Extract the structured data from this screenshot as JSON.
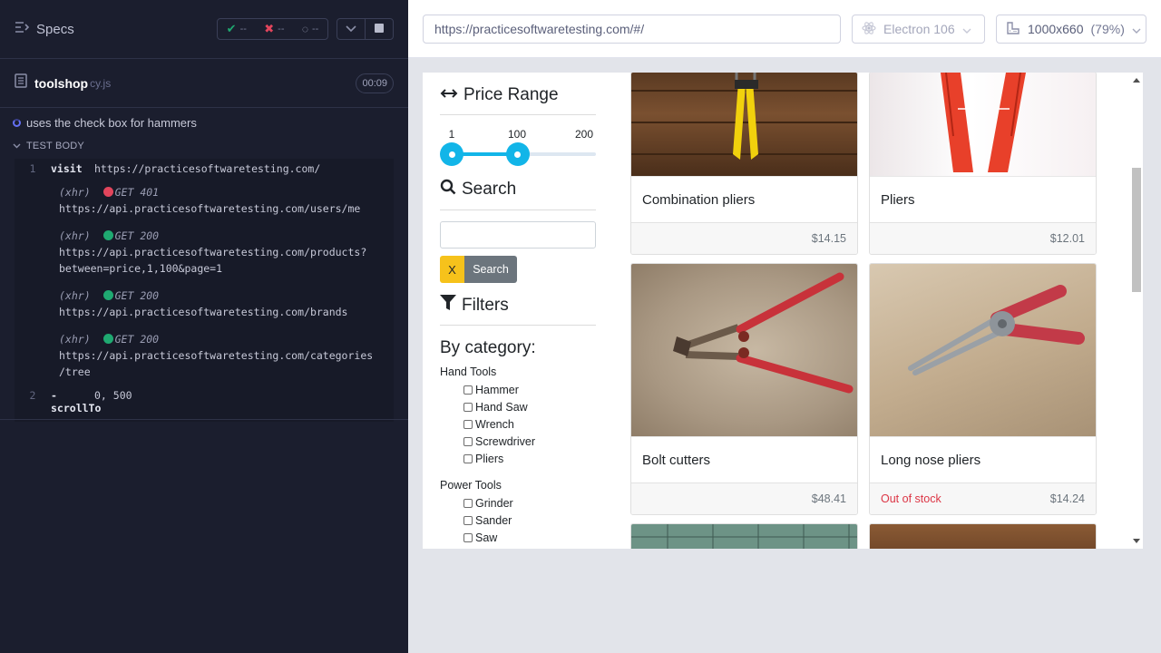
{
  "runner": {
    "specs_label": "Specs",
    "stats": {
      "passed": "--",
      "failed": "--",
      "pending": "--"
    },
    "spec": {
      "name": "toolshop",
      "ext": "cy.js",
      "duration": "00:09"
    },
    "test_title": "uses the check box for hammers",
    "test_body_label": "TEST BODY",
    "commands": [
      {
        "num": "1",
        "name": "visit",
        "message": "https://practicesoftwaretesting.com/"
      },
      {
        "num": "2",
        "name": "-scrollTo",
        "message": "0, 500"
      }
    ],
    "xhr": [
      {
        "tag": "(xhr)",
        "status_color": "#e2455c",
        "method": "GET 401",
        "url": "https://api.practicesoftwaretesting.com/users/me"
      },
      {
        "tag": "(xhr)",
        "status_color": "#1fa971",
        "method": "GET 200",
        "url": "https://api.practicesoftwaretesting.com/products?between=price,1,100&page=1"
      },
      {
        "tag": "(xhr)",
        "status_color": "#1fa971",
        "method": "GET 200",
        "url": "https://api.practicesoftwaretesting.com/brands"
      },
      {
        "tag": "(xhr)",
        "status_color": "#1fa971",
        "method": "GET 200",
        "url": "https://api.practicesoftwaretesting.com/categories/tree"
      }
    ]
  },
  "aut": {
    "url": "https://practicesoftwaretesting.com/#/",
    "browser": "Electron 106",
    "viewport": "1000x660",
    "zoom": "(79%)"
  },
  "app": {
    "price_range": {
      "title": "Price Range",
      "min_label": "1",
      "current_label": "100",
      "max_label": "200",
      "min": 1,
      "max": 200,
      "low_value": 1,
      "high_value": 100
    },
    "search": {
      "title": "Search",
      "clear_label": "X",
      "button_label": "Search",
      "value": ""
    },
    "filters": {
      "title": "Filters",
      "by_category": "By category:",
      "groups": [
        {
          "name": "Hand Tools",
          "items": [
            "Hammer",
            "Hand Saw",
            "Wrench",
            "Screwdriver",
            "Pliers"
          ]
        },
        {
          "name": "Power Tools",
          "items": [
            "Grinder",
            "Sander",
            "Saw"
          ]
        }
      ]
    },
    "products": [
      {
        "name": "Combination pliers",
        "price": "$14.15",
        "stock": ""
      },
      {
        "name": "Pliers",
        "price": "$12.01",
        "stock": ""
      },
      {
        "name": "Bolt cutters",
        "price": "$48.41",
        "stock": ""
      },
      {
        "name": "Long nose pliers",
        "price": "$14.24",
        "stock": "Out of stock"
      }
    ]
  }
}
